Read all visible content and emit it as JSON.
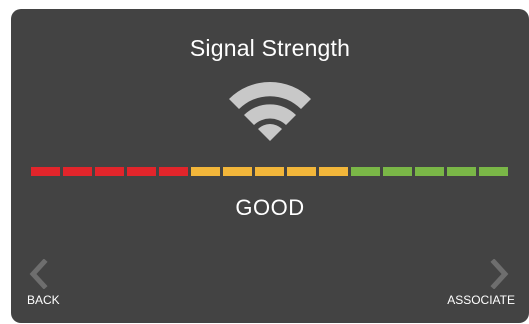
{
  "screen": {
    "title": "Signal Strength",
    "status": "GOOD",
    "icon": "wifi-icon"
  },
  "signal_meter": {
    "segments_total": 15,
    "segments": [
      {
        "color": "#e2252b"
      },
      {
        "color": "#e2252b"
      },
      {
        "color": "#e2252b"
      },
      {
        "color": "#e2252b"
      },
      {
        "color": "#e2252b"
      },
      {
        "color": "#f2b63a"
      },
      {
        "color": "#f2b63a"
      },
      {
        "color": "#f2b63a"
      },
      {
        "color": "#f2b63a"
      },
      {
        "color": "#f2b63a"
      },
      {
        "color": "#7ab747"
      },
      {
        "color": "#7ab747"
      },
      {
        "color": "#7ab747"
      },
      {
        "color": "#7ab747"
      },
      {
        "color": "#7ab747"
      }
    ]
  },
  "nav": {
    "back_label": "BACK",
    "back_icon": "chevron-left-icon",
    "associate_label": "ASSOCIATE",
    "associate_icon": "chevron-right-icon"
  },
  "colors": {
    "panel": "#434343",
    "text": "#ffffff",
    "icon": "#c8c8c8",
    "chevron": "#6e6e6e"
  }
}
